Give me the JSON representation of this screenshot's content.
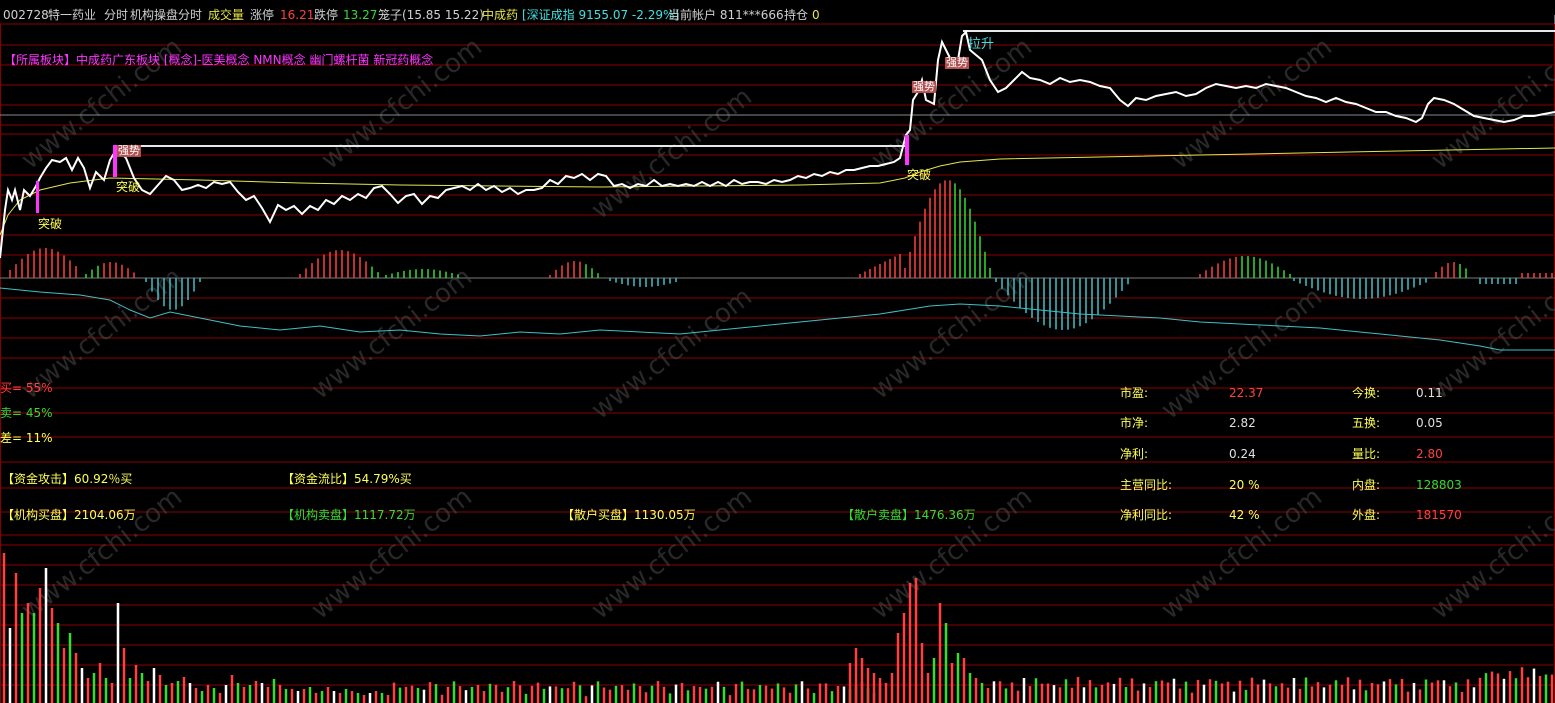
{
  "header": {
    "code": "002728",
    "name": "特一药业",
    "view_1": "分时",
    "view_2": "机构操盘分时",
    "view_3": "成交量",
    "limit_up_label": "涨停",
    "limit_up_value": "16.21",
    "limit_down_label": "跌停",
    "limit_down_value": "13.27",
    "cage_text": "笼子(15.85 15.22)",
    "sector": "中成药",
    "index_text": "[深证成指 9155.07 -2.29%]",
    "account_text": "当前帐户 811***666",
    "position_label": "持仓",
    "position_value": "0"
  },
  "concept_text": "【所属板块】中成药广东板块 [概念]-医美概念 NMN概念 幽门螺杆菌 新冠药概念",
  "price_labels": {
    "tupo_1": "突破",
    "qiangshi_1": "强势",
    "tupo_2": "突破",
    "tupo_3": "突破",
    "qiangshi_2": "强势",
    "qiangshi_3": "强势",
    "lasheng": "拉升"
  },
  "ratios": {
    "buy": "买= 55%",
    "sell": "卖= 45%",
    "diff": "差= 11%"
  },
  "funds": {
    "attack": "【资金攻击】60.92％买",
    "flow": "【资金流比】54.79%买",
    "inst_buy": "【机构买盘】2104.06万",
    "inst_sell": "【机构卖盘】1117.72万",
    "retail_buy": "【散户买盘】1130.05万",
    "retail_sell": "【散户卖盘】1476.36万"
  },
  "stats": {
    "pe_label": "市盈:",
    "pe_value": "22.37",
    "pb_label": "市净:",
    "pb_value": "2.82",
    "profit_label": "净利:",
    "profit_value": "0.24",
    "rev_yoy_label": "主营同比:",
    "rev_yoy_value": "20 %",
    "np_yoy_label": "净利同比:",
    "np_yoy_value": "42 %",
    "turnover_label": "今换:",
    "turnover_value": "0.11",
    "turnover5_label": "五换:",
    "turnover5_value": "0.05",
    "vol_ratio_label": "量比:",
    "vol_ratio_value": "2.80",
    "inner_label": "内盘:",
    "inner_value": "128803",
    "outer_label": "外盘:",
    "outer_value": "181570"
  },
  "watermark": "www.cfchi.com",
  "colors": {
    "price_line": "#ffffff",
    "avg_line": "#e6e64a",
    "grid": "#8a0000",
    "up": "#ff4040",
    "down": "#33dd33",
    "flow_line": "#3fc0c8",
    "magenta": "#ff33ff",
    "yellow": "#ffff55",
    "cyan": "#40e0e0"
  }
}
